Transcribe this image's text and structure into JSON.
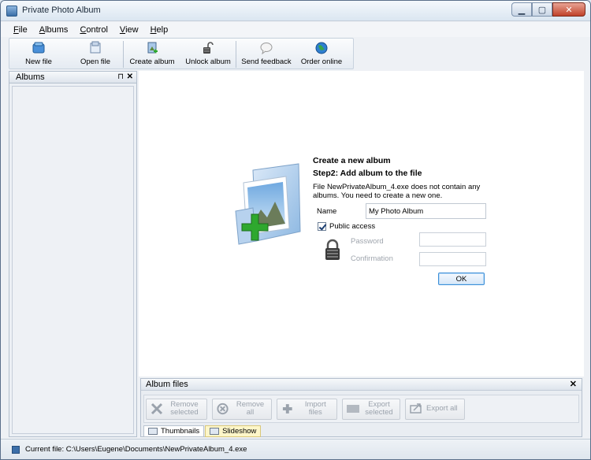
{
  "window": {
    "title": "Private Photo Album"
  },
  "menu": [
    {
      "label": "File",
      "u": "F",
      "rest": "ile"
    },
    {
      "label": "Albums",
      "u": "A",
      "rest": "lbums"
    },
    {
      "label": "Control",
      "u": "C",
      "rest": "ontrol"
    },
    {
      "label": "View",
      "u": "V",
      "rest": "iew"
    },
    {
      "label": "Help",
      "u": "H",
      "rest": "elp"
    }
  ],
  "toolbar": {
    "new_file": "New file",
    "open_file": "Open file",
    "create_album": "Create album",
    "unlock_album": "Unlock album",
    "send_feedback": "Send feedback",
    "order_online": "Order online"
  },
  "albums_panel": {
    "title": "Albums"
  },
  "wizard": {
    "title": "Create a new album",
    "step": "Step2: Add album to the file",
    "description": "File NewPrivateAlbum_4.exe does not contain any albums. You need to create a new one.",
    "name_label": "Name",
    "name_value": "My Photo Album",
    "public_access_label": "Public access",
    "password_label": "Password",
    "confirmation_label": "Confirmation",
    "ok_label": "OK"
  },
  "files_panel": {
    "title": "Album files",
    "remove_selected": "Remove selected",
    "remove_all": "Remove all",
    "import_files": "Import files",
    "export_selected": "Export selected",
    "export_all": "Export all"
  },
  "tabs": {
    "thumbnails": "Thumbnails",
    "slideshow": "Slideshow"
  },
  "status": {
    "text": "Current file: C:\\Users\\Eugene\\Documents\\NewPrivateAlbum_4.exe"
  },
  "colors": {
    "accent": "#3d8fd8",
    "add_green": "#2ea82e"
  }
}
